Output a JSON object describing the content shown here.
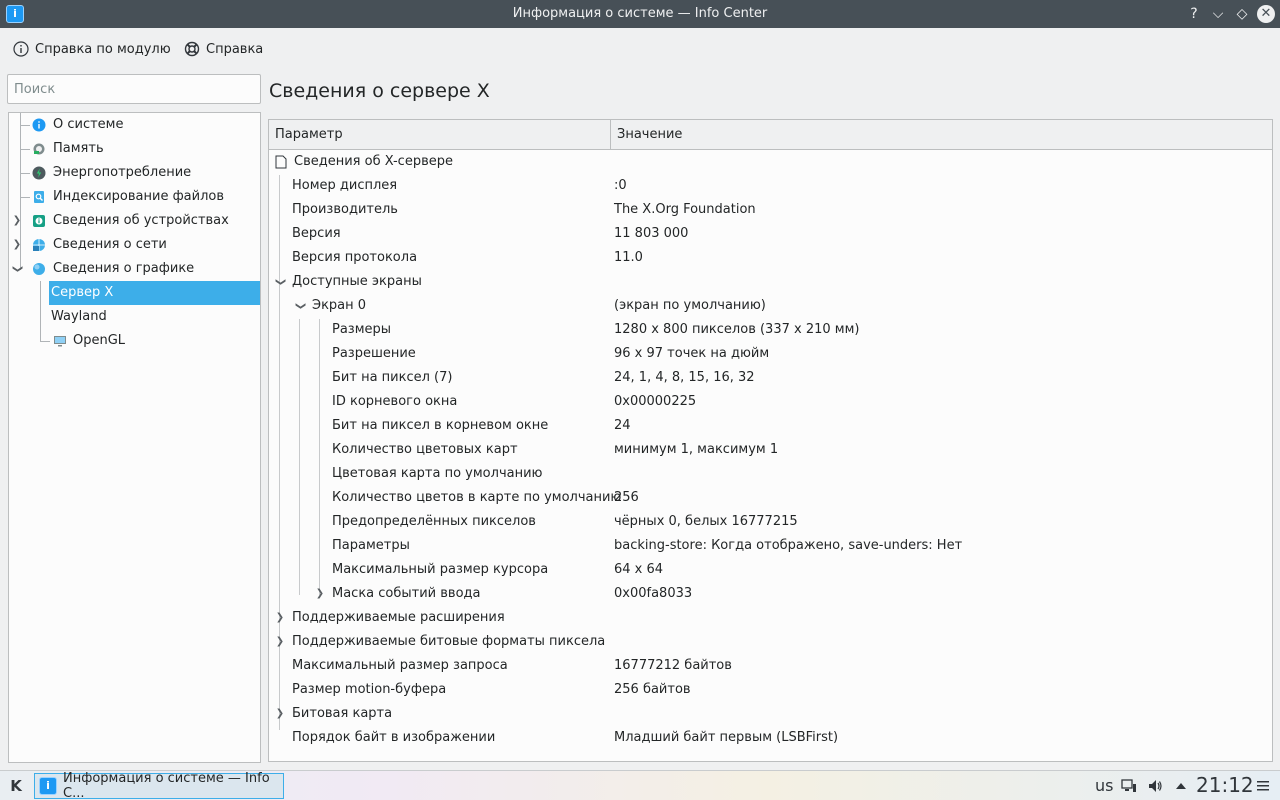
{
  "window": {
    "title": "Информация о системе — Info Center",
    "controls": [
      "?",
      "⌵",
      "◇",
      "✕"
    ]
  },
  "toolbar": {
    "module_help": "Справка по модулю",
    "help": "Справка"
  },
  "sidebar": {
    "search_placeholder": "Поиск",
    "items": [
      {
        "label": "О системе"
      },
      {
        "label": "Память"
      },
      {
        "label": "Энергопотребление"
      },
      {
        "label": "Индексирование файлов"
      },
      {
        "label": "Сведения об устройствах"
      },
      {
        "label": "Сведения о сети"
      },
      {
        "label": "Сведения о графике"
      },
      {
        "label": "Сервер X"
      },
      {
        "label": "Wayland"
      },
      {
        "label": "OpenGL"
      }
    ]
  },
  "main": {
    "title": "Сведения о сервере X",
    "columns": {
      "param": "Параметр",
      "value": "Значение"
    },
    "rows": [
      {
        "k": "Сведения об X-сервере",
        "v": ""
      },
      {
        "k": "Номер дисплея",
        "v": ":0"
      },
      {
        "k": "Производитель",
        "v": "The X.Org Foundation"
      },
      {
        "k": "Версия",
        "v": "11 803 000"
      },
      {
        "k": "Версия протокола",
        "v": "11.0"
      },
      {
        "k": "Доступные экраны",
        "v": ""
      },
      {
        "k": "Экран 0",
        "v": "(экран по умолчанию)"
      },
      {
        "k": "Размеры",
        "v": "1280 x 800 пикселов (337 x 210 мм)"
      },
      {
        "k": "Разрешение",
        "v": "96 x 97 точек на дюйм"
      },
      {
        "k": "Бит на пиксел (7)",
        "v": "24, 1, 4, 8, 15, 16, 32"
      },
      {
        "k": "ID корневого окна",
        "v": "0x00000225"
      },
      {
        "k": "Бит на пиксел в корневом окне",
        "v": "24"
      },
      {
        "k": "Количество цветовых карт",
        "v": "минимум 1, максимум 1"
      },
      {
        "k": "Цветовая карта по умолчанию",
        "v": ""
      },
      {
        "k": "Количество цветов в карте по умолчанию",
        "v": "256"
      },
      {
        "k": "Предопределённых пикселов",
        "v": "чёрных 0, белых 16777215"
      },
      {
        "k": "Параметры",
        "v": "backing-store: Когда отображено, save-unders: Нет"
      },
      {
        "k": "Максимальный размер курсора",
        "v": "64 x 64"
      },
      {
        "k": "Маска событий ввода",
        "v": "0x00fa8033"
      },
      {
        "k": "Поддерживаемые расширения",
        "v": ""
      },
      {
        "k": "Поддерживаемые битовые форматы пиксела",
        "v": ""
      },
      {
        "k": "Максимальный размер запроса",
        "v": "16777212 байтов"
      },
      {
        "k": "Размер motion-буфера",
        "v": "256 байтов"
      },
      {
        "k": "Битовая карта",
        "v": ""
      },
      {
        "k": "Порядок байт в изображении",
        "v": "Младший байт первым (LSBFirst)"
      }
    ]
  },
  "taskbar": {
    "task_label": "Информация о системе — Info C...",
    "keyboard_layout": "us",
    "clock": "21:12"
  },
  "colors": {
    "accent": "#3daee9",
    "titlebar": "#475057"
  }
}
